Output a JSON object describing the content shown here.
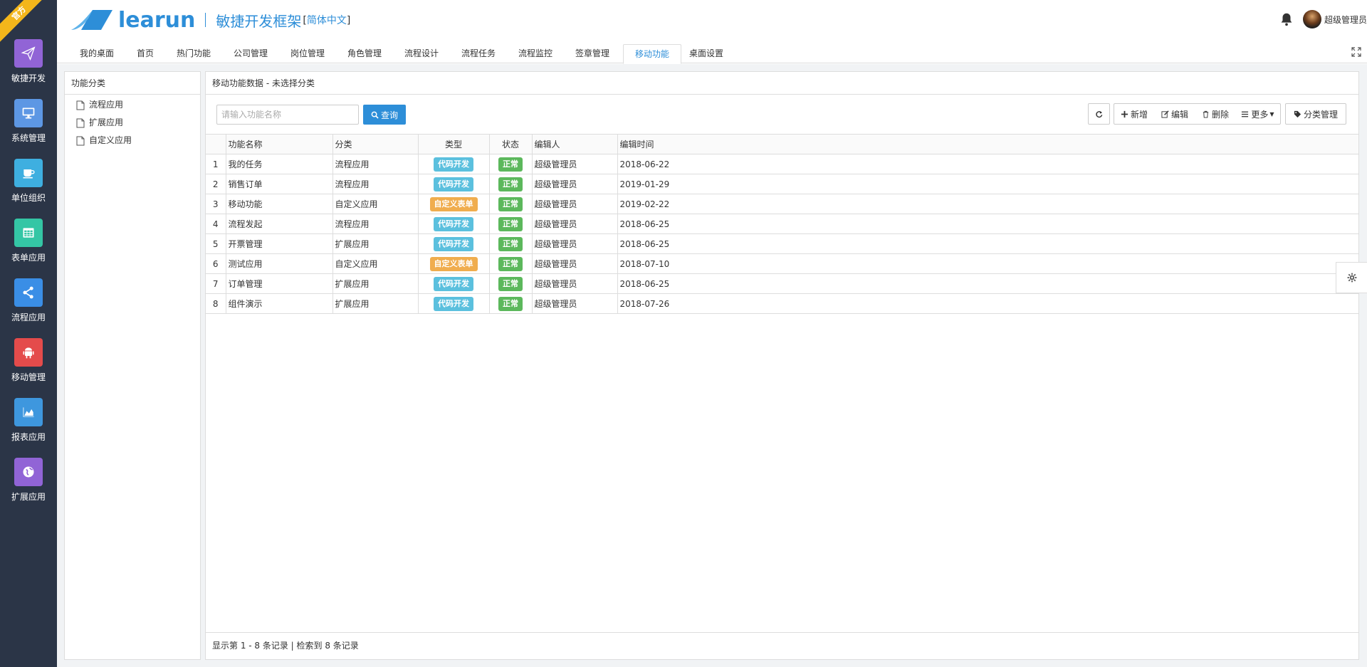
{
  "ribbon": "官方",
  "sidebar": {
    "items": [
      {
        "label": "敏捷开发",
        "icon": "paper-plane-icon",
        "color": "#9164d6"
      },
      {
        "label": "系统管理",
        "icon": "monitor-icon",
        "color": "#5d97e4"
      },
      {
        "label": "单位组织",
        "icon": "coffee-icon",
        "color": "#3eafe0"
      },
      {
        "label": "表单应用",
        "icon": "table-icon",
        "color": "#34c6a5"
      },
      {
        "label": "流程应用",
        "icon": "share-icon",
        "color": "#3a8ee6"
      },
      {
        "label": "移动管理",
        "icon": "android-icon",
        "color": "#e44b4b"
      },
      {
        "label": "报表应用",
        "icon": "area-chart-icon",
        "color": "#3e97de"
      },
      {
        "label": "扩展应用",
        "icon": "globe-icon",
        "color": "#9164d6"
      }
    ]
  },
  "header": {
    "logo_text": "learun",
    "subtitle": "敏捷开发框架",
    "lang_open": "[",
    "lang": "简体中文",
    "lang_close": "]",
    "user_name": "超级管理员"
  },
  "tabs": [
    {
      "label": "我的桌面",
      "active": false
    },
    {
      "label": "首页",
      "active": false
    },
    {
      "label": "热门功能",
      "active": false
    },
    {
      "label": "公司管理",
      "active": false
    },
    {
      "label": "岗位管理",
      "active": false
    },
    {
      "label": "角色管理",
      "active": false
    },
    {
      "label": "流程设计",
      "active": false
    },
    {
      "label": "流程任务",
      "active": false
    },
    {
      "label": "流程监控",
      "active": false
    },
    {
      "label": "签章管理",
      "active": false
    },
    {
      "label": "移动功能",
      "active": true
    },
    {
      "label": "桌面设置",
      "active": false
    }
  ],
  "categories": {
    "title": "功能分类",
    "items": [
      "流程应用",
      "扩展应用",
      "自定义应用"
    ]
  },
  "main": {
    "title": "移动功能数据 - 未选择分类",
    "search_placeholder": "请输入功能名称",
    "query_label": "查询",
    "buttons": {
      "add": "新增",
      "edit": "编辑",
      "delete": "删除",
      "more": "更多",
      "category": "分类管理"
    },
    "columns": [
      "功能名称",
      "分类",
      "类型",
      "状态",
      "编辑人",
      "编辑时间"
    ],
    "rows": [
      {
        "no": "1",
        "name": "我的任务",
        "category": "流程应用",
        "type": "代码开发",
        "status": "正常",
        "editor": "超级管理员",
        "time": "2018-06-22"
      },
      {
        "no": "2",
        "name": "销售订单",
        "category": "流程应用",
        "type": "代码开发",
        "status": "正常",
        "editor": "超级管理员",
        "time": "2019-01-29"
      },
      {
        "no": "3",
        "name": "移动功能",
        "category": "自定义应用",
        "type": "自定义表单",
        "status": "正常",
        "editor": "超级管理员",
        "time": "2019-02-22"
      },
      {
        "no": "4",
        "name": "流程发起",
        "category": "流程应用",
        "type": "代码开发",
        "status": "正常",
        "editor": "超级管理员",
        "time": "2018-06-25"
      },
      {
        "no": "5",
        "name": "开票管理",
        "category": "扩展应用",
        "type": "代码开发",
        "status": "正常",
        "editor": "超级管理员",
        "time": "2018-06-25"
      },
      {
        "no": "6",
        "name": "测试应用",
        "category": "自定义应用",
        "type": "自定义表单",
        "status": "正常",
        "editor": "超级管理员",
        "time": "2018-07-10"
      },
      {
        "no": "7",
        "name": "订单管理",
        "category": "扩展应用",
        "type": "代码开发",
        "status": "正常",
        "editor": "超级管理员",
        "time": "2018-06-25"
      },
      {
        "no": "8",
        "name": "组件演示",
        "category": "扩展应用",
        "type": "代码开发",
        "status": "正常",
        "editor": "超级管理员",
        "time": "2018-07-26"
      }
    ],
    "footer": "显示第 1 - 8 条记录 | 检索到 8 条记录"
  },
  "colors": {
    "brand": "#2d8ed8",
    "label_code": "#5bc0de",
    "label_form": "#f0ad4e",
    "label_ok": "#5cb85c",
    "sidebar_bg": "#2b3547"
  }
}
